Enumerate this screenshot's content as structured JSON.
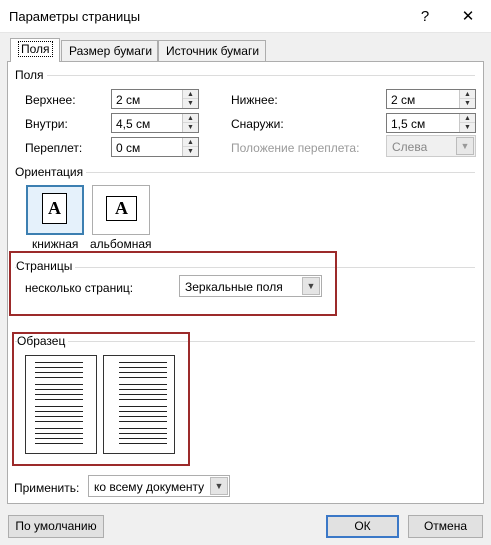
{
  "window": {
    "title": "Параметры страницы",
    "help_glyph": "?",
    "close_glyph": "✕"
  },
  "tabs": [
    {
      "label": "Поля",
      "active": true
    },
    {
      "label": "Размер бумаги",
      "active": false
    },
    {
      "label": "Источник бумаги",
      "active": false
    }
  ],
  "margins": {
    "group_label": "Поля",
    "top": {
      "label": "Верхнее:",
      "value": "2 см"
    },
    "bottom": {
      "label": "Нижнее:",
      "value": "2 см"
    },
    "inside": {
      "label": "Внутри:",
      "value": "4,5 см"
    },
    "outside": {
      "label": "Снаружи:",
      "value": "1,5 см"
    },
    "gutter": {
      "label": "Переплет:",
      "value": "0 см"
    },
    "gutter_position": {
      "label": "Положение переплета:",
      "value": "Слева"
    }
  },
  "orientation": {
    "group_label": "Ориентация",
    "portrait": {
      "label": "книжная",
      "glyph": "A",
      "selected": true
    },
    "landscape": {
      "label": "альбомная",
      "glyph": "A",
      "selected": false
    }
  },
  "pages": {
    "group_label": "Страницы",
    "multiple_label": "несколько страниц:",
    "multiple_value": "Зеркальные поля"
  },
  "preview": {
    "group_label": "Образец"
  },
  "apply": {
    "label": "Применить:",
    "value": "ко всему документу"
  },
  "buttons": {
    "default_label": "По умолчанию",
    "ok": "ОК",
    "cancel": "Отмена"
  },
  "colors": {
    "highlight_border": "#9c2a2a",
    "selected_accent": "#3c7fb1",
    "default_button_border": "#3b78c7"
  }
}
